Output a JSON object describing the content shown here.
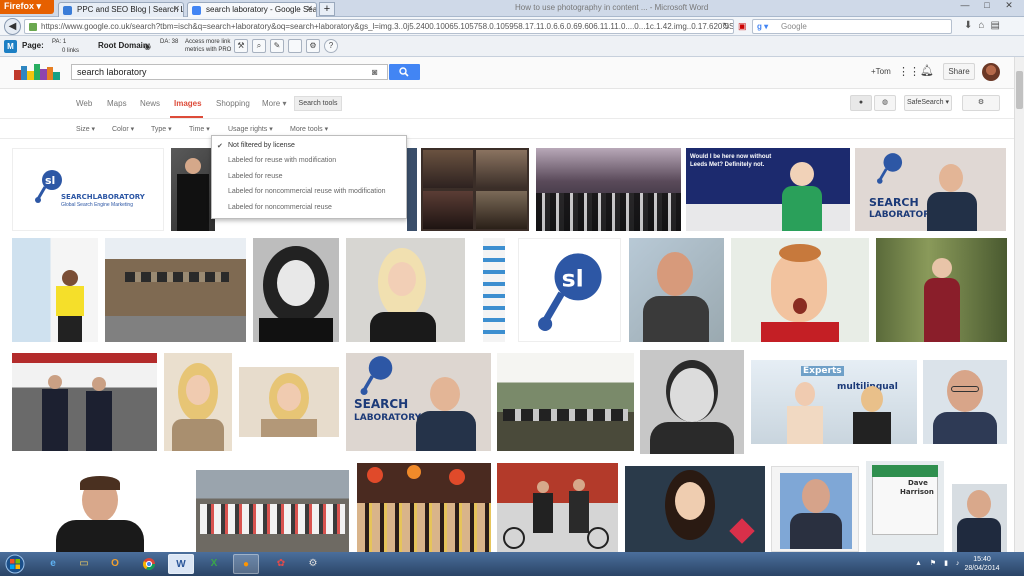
{
  "browser": {
    "app_button": "Firefox",
    "tabs": [
      {
        "title": "PPC and SEO Blog | Search Laborator..."
      },
      {
        "title": "search laboratory - Google Search"
      }
    ],
    "inactive_window_title": "How to use photography in content ... - Microsoft Word",
    "url": "https://www.google.co.uk/search?tbm=isch&q=search+laboratory&oq=search+laboratory&gs_l=img.3..0j5.2400.10065.105758.0.105958.17.11.0.6.6.0.69.606.11.11.0....0...1c.1.42.img..0.17.620.5SH3Ekm4HHs",
    "search_engine_placeholder": "Google",
    "search_engine_badge": "8"
  },
  "mozbar": {
    "logo": "M",
    "page_label": "Page:",
    "pa": "PA: 1",
    "links": "0 links",
    "root_label": "Root Domain:",
    "da": "DA: 38",
    "pro_line1": "Access more link",
    "pro_line2": "metrics with PRO"
  },
  "google": {
    "query": "search laboratory",
    "plus_user": "+Tom",
    "share": "Share",
    "tabs": [
      "Web",
      "Maps",
      "News",
      "Images",
      "Shopping",
      "More ▾"
    ],
    "search_tools": "Search tools",
    "safesearch": "SafeSearch ▾",
    "tools": [
      "Size ▾",
      "Color ▾",
      "Type ▾",
      "Time ▾",
      "Usage rights ▾",
      "More tools ▾"
    ],
    "usage_rights_options": [
      "Not filtered by license",
      "Labeled for reuse with modification",
      "Labeled for reuse",
      "Labeled for noncommercial reuse with modification",
      "Labeled for noncommercial reuse"
    ],
    "usage_rights_selected": 0
  },
  "results": {
    "logo_title": "SEARCHLABORATORY",
    "logo_tagline": "Global Search Engine Marketing",
    "logo_mark": "sl",
    "banner_line1": "Would I be here now without",
    "banner_line2": "Leeds Met? Definitely not.",
    "search_word": "SEARCH",
    "laboratory_word": "LABORATORY",
    "experts_words": "Experts",
    "multilingual_words": "multilingual",
    "sign_name": "Dave",
    "sign_surname": "Harrison"
  },
  "taskbar": {
    "time": "15:40",
    "date": "28/04/2014",
    "apps": [
      "IE",
      "Explorer",
      "Outlook",
      "Chrome",
      "Word",
      "Excel",
      "Firefox",
      "Paint",
      "Tools"
    ]
  },
  "colors": {
    "google_blue": "#4285f4",
    "images_red": "#dd4b39",
    "firefox_orange": "#e66000",
    "sl_blue": "#2d57a5"
  }
}
